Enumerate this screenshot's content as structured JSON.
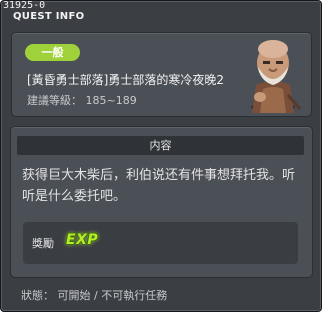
{
  "window": {
    "quest_id": "31925-0",
    "title": "QUEST INFO"
  },
  "quest": {
    "category": "一般",
    "name": "[黃昏勇士部落]勇士部落的寒冷夜晚2",
    "level_label": "建議等級",
    "level_range": "185~189",
    "npc_icon": "elder-npc-icon"
  },
  "content": {
    "header": "内容",
    "text": "获得巨大木柴后，利伯说还有件事想拜托我。听听是什么委托吧。"
  },
  "reward": {
    "label": "獎勵",
    "exp_icon_text": "EXP"
  },
  "status": {
    "label": "狀態",
    "value": "可開始 / 不可執行任務"
  }
}
